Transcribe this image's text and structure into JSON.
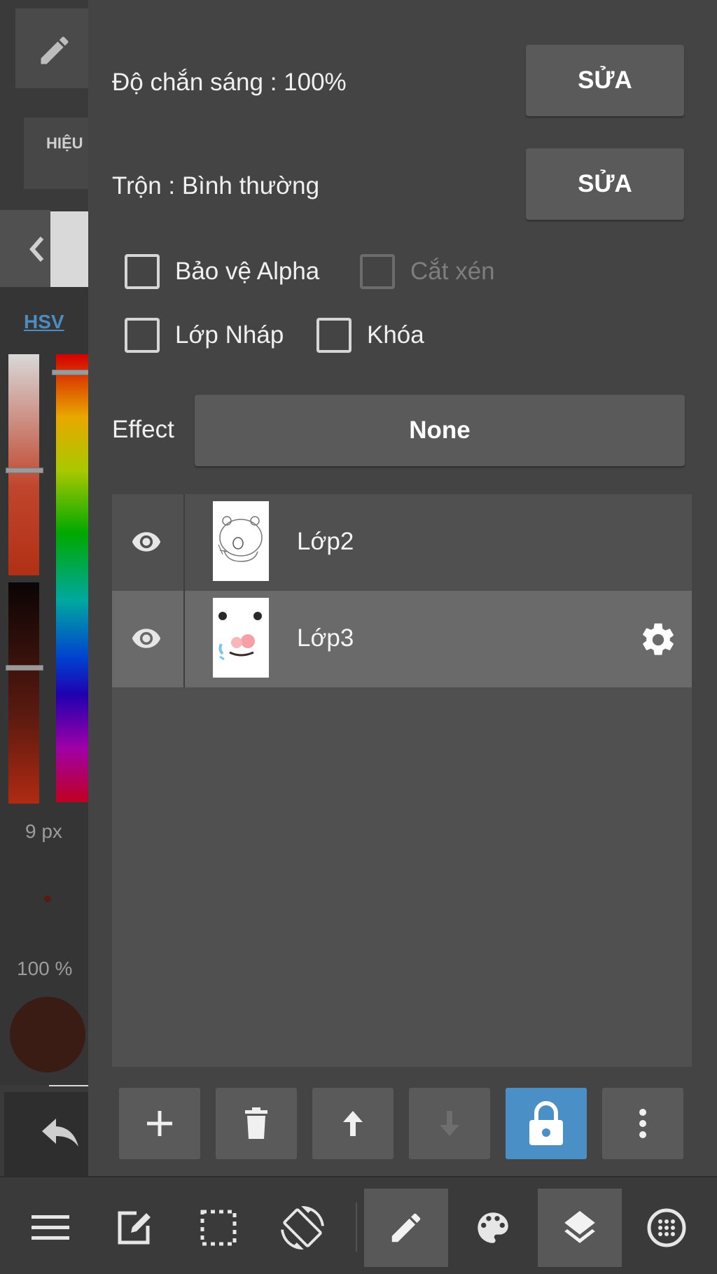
{
  "panel": {
    "opacity_label": "Độ chắn sáng : 100%",
    "opacity_edit": "SỬA",
    "blend_label": "Trộn : Bình thường",
    "blend_edit": "SỬA",
    "checkboxes": {
      "protect_alpha": "Bảo vệ Alpha",
      "clipping": "Cắt xén",
      "draft_layer": "Lớp Nháp",
      "lock": "Khóa"
    },
    "effect_label": "Effect",
    "effect_value": "None"
  },
  "layers": [
    {
      "name": "Lớp2",
      "visible": true,
      "selected": false
    },
    {
      "name": "Lớp3",
      "visible": true,
      "selected": true
    }
  ],
  "toolbar": {
    "buttons": [
      "add-icon",
      "trash-icon",
      "arrow-up-icon",
      "arrow-down-icon",
      "lock-icon",
      "more-vertical-icon"
    ],
    "active": "lock-icon",
    "accent": "#4a90c6"
  },
  "left_strip": {
    "effect_button": "HIỆU",
    "color_mode": "HSV",
    "brush_size": "9 px",
    "brush_opacity": "100 %",
    "current_color": "#3a1c14"
  },
  "bottom_nav": {
    "items": [
      "menu-icon",
      "edit-icon",
      "selection-icon",
      "rotate-screen-icon",
      "pen-icon",
      "palette-icon",
      "layers-icon",
      "grid-icon"
    ],
    "active": [
      "pen-icon",
      "layers-icon"
    ]
  }
}
